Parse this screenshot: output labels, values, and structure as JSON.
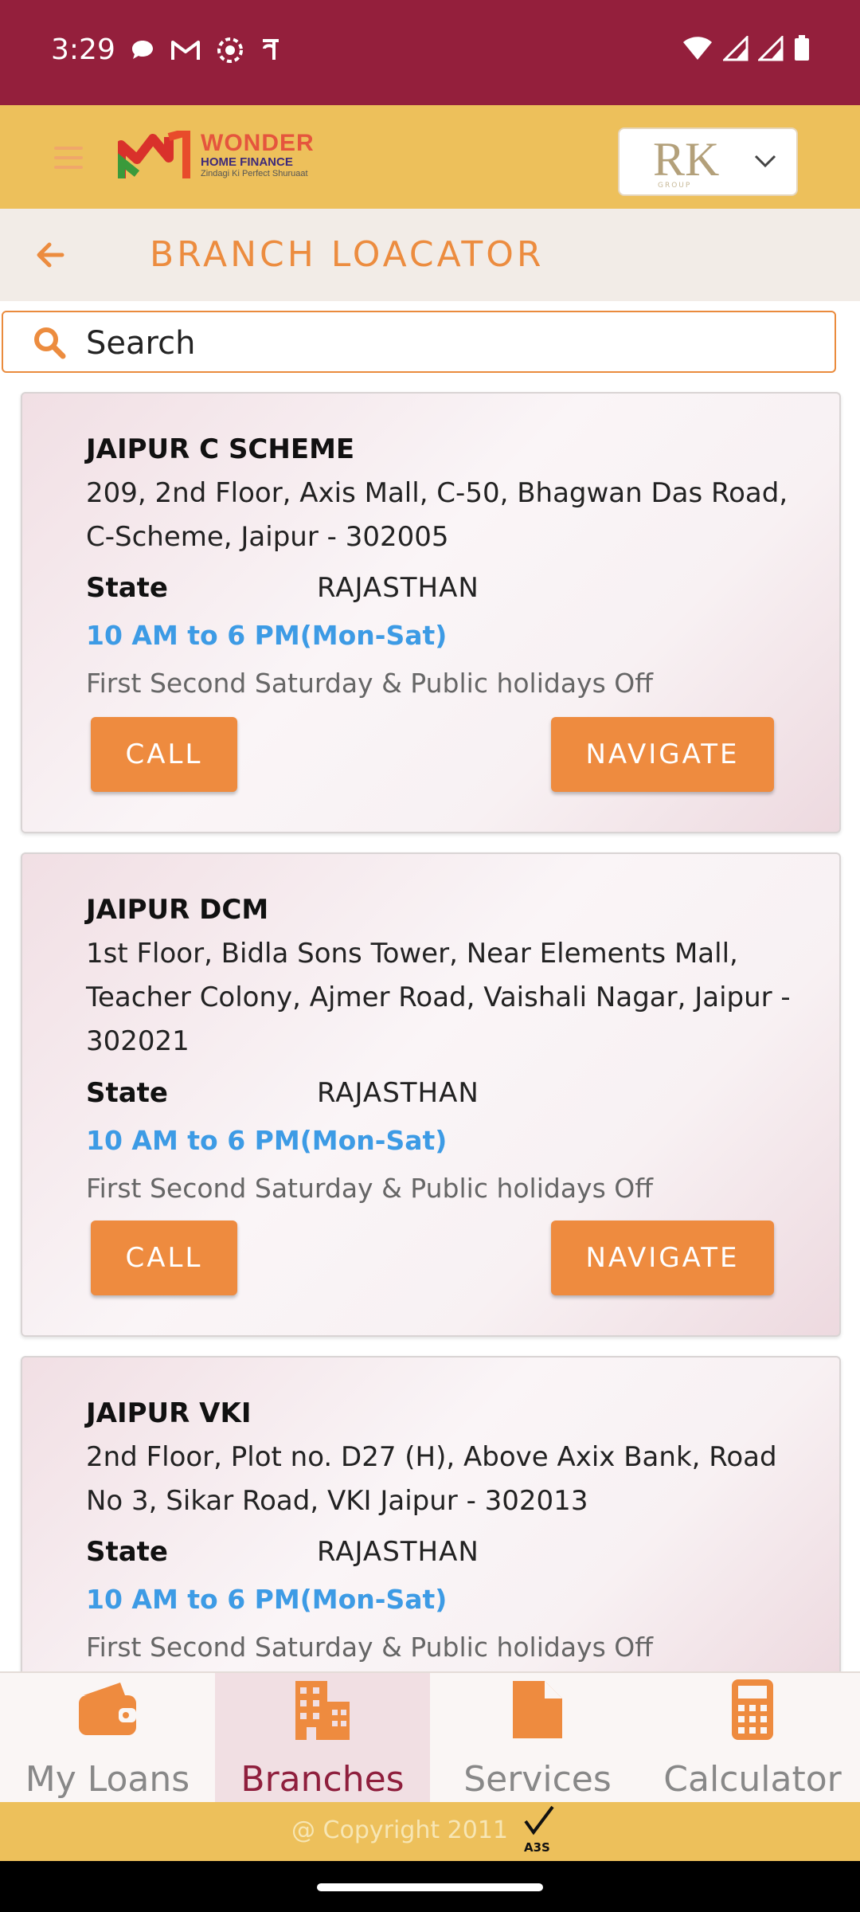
{
  "status_bar": {
    "time": "3:29"
  },
  "header": {
    "logo": {
      "brand": "WONDER",
      "sub": "HOME FINANCE",
      "tagline": "Zindagi Ki Perfect Shuruaat"
    },
    "group_select": {
      "logo_text": "RK",
      "logo_sub": "GROUP"
    }
  },
  "page": {
    "title": "BRANCH LOACATOR"
  },
  "search": {
    "placeholder": "Search"
  },
  "branches": [
    {
      "name": "JAIPUR C SCHEME",
      "address": "209, 2nd Floor, Axis Mall, C-50, Bhagwan Das Road, C-Scheme, Jaipur - 302005",
      "state_label": "State",
      "state": "RAJASTHAN",
      "hours": "10 AM to 6 PM(Mon-Sat)",
      "off": "First Second Saturday & Public holidays Off",
      "call_label": "CALL",
      "navigate_label": "NAVIGATE"
    },
    {
      "name": "JAIPUR DCM",
      "address": "1st Floor, Bidla Sons Tower, Near Elements Mall, Teacher Colony, Ajmer Road, Vaishali Nagar, Jaipur - 302021",
      "state_label": "State",
      "state": "RAJASTHAN",
      "hours": "10 AM to 6 PM(Mon-Sat)",
      "off": "First Second Saturday & Public holidays Off",
      "call_label": "CALL",
      "navigate_label": "NAVIGATE"
    },
    {
      "name": "JAIPUR VKI",
      "address": "2nd Floor, Plot no. D27 (H), Above Axix Bank, Road No 3, Sikar Road, VKI Jaipur - 302013",
      "state_label": "State",
      "state": "RAJASTHAN",
      "hours": "10 AM to 6 PM(Mon-Sat)",
      "off": "First Second Saturday & Public holidays Off"
    }
  ],
  "bottom_nav": [
    {
      "label": "My Loans",
      "icon": "wallet-icon"
    },
    {
      "label": "Branches",
      "icon": "building-icon",
      "active": true
    },
    {
      "label": "Services",
      "icon": "document-icon"
    },
    {
      "label": "Calculator",
      "icon": "calculator-icon"
    }
  ],
  "footer": {
    "copyright": "@ Copyright 2011",
    "badge": "A3S"
  },
  "colors": {
    "status_bar": "#941f3c",
    "header": "#edc05b",
    "accent": "#ee8b3f",
    "hours": "#3d9be5",
    "active_nav": "#8f1f3d"
  }
}
